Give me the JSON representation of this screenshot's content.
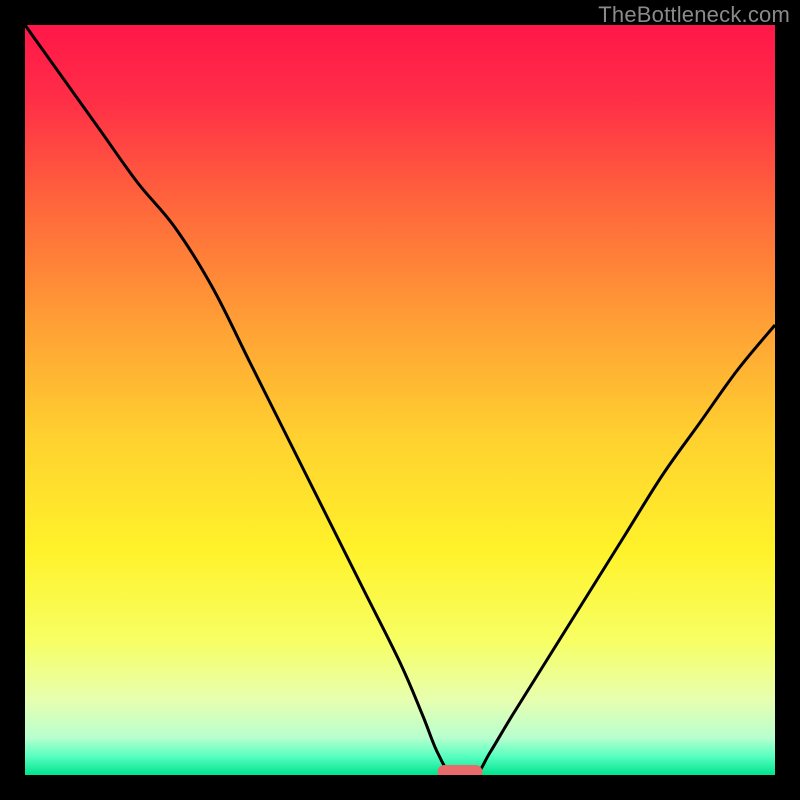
{
  "watermark": "TheBottleneck.com",
  "colors": {
    "frame": "#000000",
    "curve": "#000000",
    "marker_fill": "#e86a6a",
    "gradient_stops": [
      {
        "offset": 0.0,
        "color": "#ff1749"
      },
      {
        "offset": 0.1,
        "color": "#ff2e47"
      },
      {
        "offset": 0.25,
        "color": "#ff6a3b"
      },
      {
        "offset": 0.4,
        "color": "#ffa035"
      },
      {
        "offset": 0.55,
        "color": "#ffd12f"
      },
      {
        "offset": 0.7,
        "color": "#fff22a"
      },
      {
        "offset": 0.82,
        "color": "#f7ff63"
      },
      {
        "offset": 0.9,
        "color": "#e7ffb0"
      },
      {
        "offset": 0.95,
        "color": "#b8ffcf"
      },
      {
        "offset": 0.975,
        "color": "#58ffc0"
      },
      {
        "offset": 1.0,
        "color": "#00e38d"
      }
    ]
  },
  "chart_data": {
    "type": "line",
    "title": "",
    "xlabel": "",
    "ylabel": "",
    "xlim": [
      0,
      100
    ],
    "ylim": [
      0,
      100
    ],
    "series": [
      {
        "name": "bottleneck-curve",
        "x": [
          0,
          5,
          10,
          15,
          20,
          25,
          30,
          35,
          40,
          45,
          50,
          53,
          55,
          57,
          60,
          62,
          65,
          70,
          75,
          80,
          85,
          90,
          95,
          100
        ],
        "values": [
          100,
          93,
          86,
          79,
          73,
          65,
          55,
          45,
          35,
          25,
          15,
          8,
          3,
          0,
          0,
          3,
          8,
          16,
          24,
          32,
          40,
          47,
          54,
          60
        ]
      }
    ],
    "marker": {
      "name": "optimal-range",
      "x_start": 55,
      "x_end": 61,
      "y": 0
    }
  }
}
